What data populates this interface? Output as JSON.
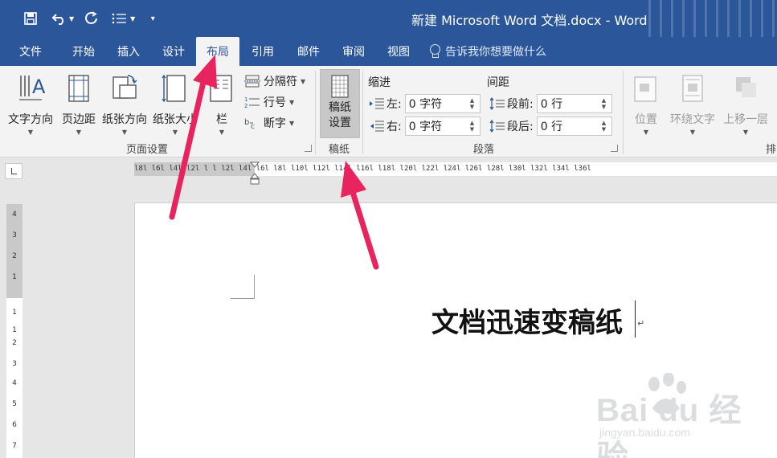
{
  "window": {
    "title": "新建 Microsoft Word 文档.docx  -  Word"
  },
  "qat": {
    "save": "save-icon",
    "undo": "undo-icon",
    "redo": "redo-icon",
    "customize": "customize-icon"
  },
  "tabs": [
    {
      "label": "文件"
    },
    {
      "label": "开始"
    },
    {
      "label": "插入"
    },
    {
      "label": "设计"
    },
    {
      "label": "布局",
      "active": true
    },
    {
      "label": "引用"
    },
    {
      "label": "邮件"
    },
    {
      "label": "审阅"
    },
    {
      "label": "视图"
    }
  ],
  "tell_me": "告诉我你想要做什么",
  "ribbon": {
    "page_setup": {
      "label": "页面设置",
      "text_direction": "文字方向",
      "margins": "页边距",
      "orientation": "纸张方向",
      "size": "纸张大小",
      "columns": "栏",
      "breaks": "分隔符",
      "line_numbers": "行号",
      "hyphenation": "断字"
    },
    "manuscript": {
      "label": "稿纸",
      "button_line1": "稿纸",
      "button_line2": "设置"
    },
    "paragraph": {
      "label": "段落",
      "indent": "缩进",
      "spacing": "间距",
      "left_label": "左:",
      "left_value": "0 字符",
      "right_label": "右:",
      "right_value": "0 字符",
      "before_label": "段前:",
      "before_value": "0 行",
      "after_label": "段后:",
      "after_value": "0 行"
    },
    "arrange": {
      "label": "排",
      "position": "位置",
      "wrap_text": "环绕文字",
      "bring_forward": "上移一层"
    }
  },
  "ruler": {
    "horizontal": "l8l  l6l  l4l  l2l  l    l  l2l  l4l  l6l  l8l  l10l  l12l  l14l  l16l  l18l  l20l  l22l  l24l  l26l  l28l  l30l  l32l  l34l  l36l",
    "vertical": [
      "4",
      "3",
      "2",
      "1",
      "1",
      "1",
      "2",
      "3",
      "4",
      "5",
      "6",
      "7"
    ]
  },
  "document": {
    "text": "文档迅速变稿纸",
    "para_mark": "↵"
  },
  "watermark": {
    "brand": "Bai du 经验",
    "url": "jingyan.baidu.com"
  },
  "colors": {
    "accent": "#2b579a",
    "arrow": "#e8245e"
  }
}
